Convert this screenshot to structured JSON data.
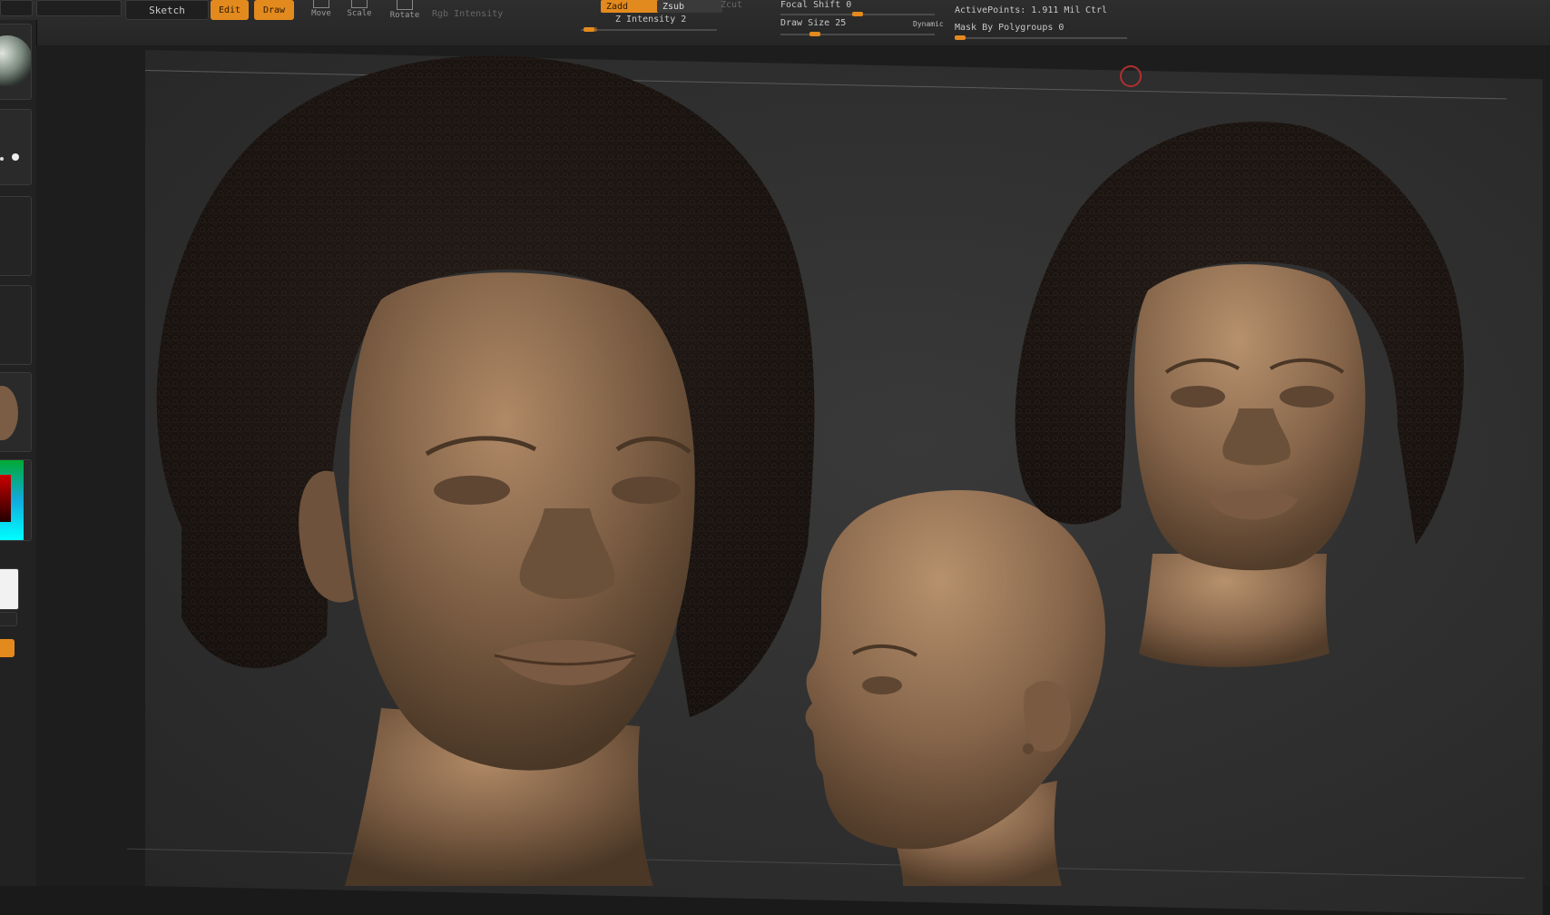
{
  "toolbar": {
    "sketch_label": "Sketch",
    "edit_label": "Edit",
    "draw_label": "Draw",
    "move_label": "Move",
    "scale_label": "Scale",
    "rotate_label": "Rotate",
    "rgb_intensity_label": "Rgb Intensity",
    "z_intensity_label": "Z Intensity 2",
    "zadd_label": "Zadd",
    "zsub_label": "Zsub",
    "zcut_label": "Zcut",
    "focal_shift_label": "Focal Shift 0",
    "draw_size_label": "Draw Size 25",
    "dynamic_label": "Dynamic",
    "active_points_label": "ActivePoints: 1.911 Mil",
    "ctrl_label": "Ctrl",
    "mask_polygroups_label": "Mask By Polygroups 0",
    "z_intensity_level": 0.02,
    "focal_shift_level": 0.5,
    "draw_size_level": 0.2,
    "mask_polygroups_level": 0.0
  },
  "colors": {
    "accent": "#e38a1e",
    "skin": "#8a6a4c",
    "hair": "#1e1714",
    "background": "#2e2e2e"
  },
  "icons": {
    "move": "move-icon",
    "scale": "scale-icon",
    "rotate": "rotate-icon",
    "cursor": "brush-cursor-icon"
  }
}
